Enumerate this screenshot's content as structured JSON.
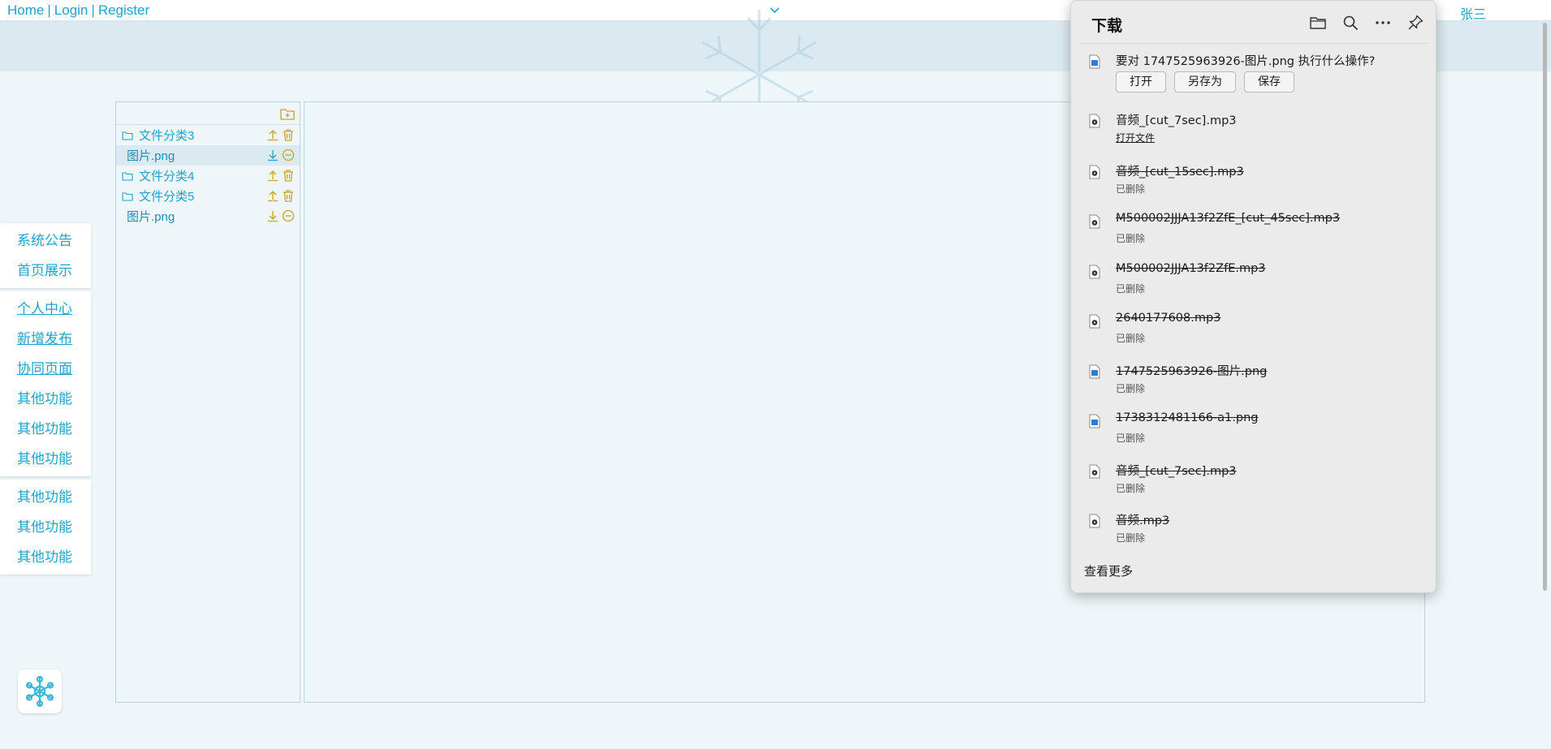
{
  "topbar": {
    "nav_home": "Home",
    "nav_sep1": "|",
    "nav_login": "Login",
    "nav_sep2": "|",
    "nav_register": "Register",
    "username": "张三"
  },
  "sidebar": {
    "group1": [
      "系统公告",
      "首页展示"
    ],
    "group2": [
      "个人中心",
      "新增发布",
      "协同页面",
      "其他功能",
      "其他功能",
      "其他功能"
    ],
    "group3": [
      "其他功能",
      "其他功能",
      "其他功能"
    ]
  },
  "filetree": {
    "rows": [
      {
        "type": "folder",
        "name": "文件分类3"
      },
      {
        "type": "file",
        "name": "图片.png"
      },
      {
        "type": "folder",
        "name": "文件分类4"
      },
      {
        "type": "folder",
        "name": "文件分类5"
      },
      {
        "type": "file",
        "name": "图片.png"
      }
    ]
  },
  "downloads": {
    "title": "下载",
    "prompt": "要对 1747525963926-图片.png 执行什么操作?",
    "btn_open": "打开",
    "btn_saveas": "另存为",
    "btn_save": "保存",
    "items": [
      {
        "name": "音频_[cut_7sec].mp3",
        "status": "打开文件"
      },
      {
        "name": "音频_[cut_15sec].mp3",
        "status": "已删除"
      },
      {
        "name": "M500002JJJA13f2ZfE_[cut_45sec].mp3",
        "status": "已删除"
      },
      {
        "name": "M500002JJJA13f2ZfE.mp3",
        "status": "已删除"
      },
      {
        "name": "2640177608.mp3",
        "status": "已删除"
      },
      {
        "name": "1747525963926-图片.png",
        "status": "已删除"
      },
      {
        "name": "1738312481166-a1.png",
        "status": "已删除"
      },
      {
        "name": "音频_[cut_7sec].mp3",
        "status": "已删除"
      },
      {
        "name": "音频.mp3",
        "status": "已删除"
      }
    ],
    "see_more": "查看更多"
  },
  "colors": {
    "accent": "#1fa4cc",
    "icon_gold": "#c9a227",
    "background": "#eef6f9",
    "banner": "#dbeaf0",
    "download_panel": "#ebebeb"
  }
}
